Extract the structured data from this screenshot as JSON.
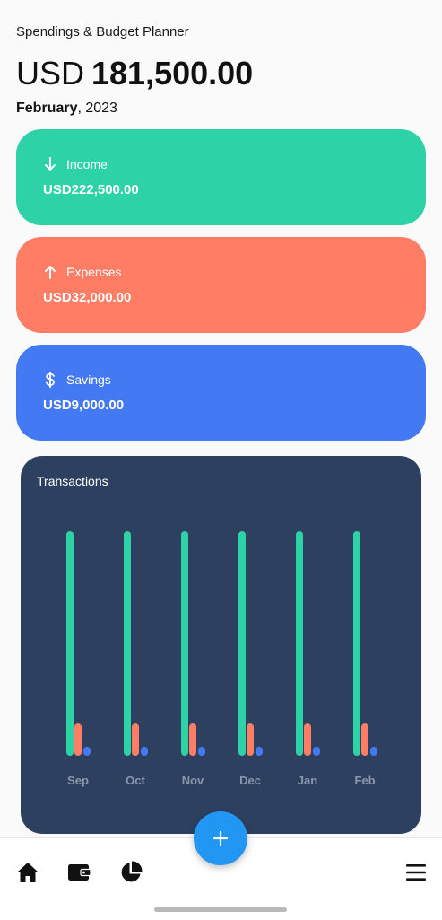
{
  "header": {
    "app_title": "Spendings & Budget Planner",
    "currency": "USD",
    "balance": "181,500.00",
    "month": "February",
    "year": ", 2023"
  },
  "cards": {
    "income": {
      "label": "Income",
      "value": "USD222,500.00",
      "icon": "arrow-down-icon",
      "color": "#2dd3a7"
    },
    "expenses": {
      "label": "Expenses",
      "value": "USD32,000.00",
      "icon": "arrow-up-icon",
      "color": "#ff7c65"
    },
    "savings": {
      "label": "Savings",
      "value": "USD9,000.00",
      "icon": "dollar-icon",
      "color": "#4479f4"
    }
  },
  "transactions": {
    "title": "Transactions"
  },
  "chart_data": {
    "type": "bar",
    "categories": [
      "Sep",
      "Oct",
      "Nov",
      "Dec",
      "Jan",
      "Feb"
    ],
    "series": [
      {
        "values": [
          222500,
          222500,
          222500,
          222500,
          222500,
          222500
        ],
        "color": "#2dd3a7"
      },
      {
        "values": [
          32000,
          32000,
          32000,
          32000,
          32000,
          32000
        ],
        "color": "#ff7c65"
      },
      {
        "values": [
          9000,
          9000,
          9000,
          9000,
          9000,
          9000
        ],
        "color": "#4479f4"
      }
    ],
    "ylim": [
      0,
      222500
    ],
    "grid": false,
    "legend": "none"
  },
  "bottom_nav": {
    "items": [
      "home-icon",
      "wallet-icon",
      "pie-chart-icon",
      "menu-icon"
    ],
    "fab_icon": "plus-icon"
  }
}
